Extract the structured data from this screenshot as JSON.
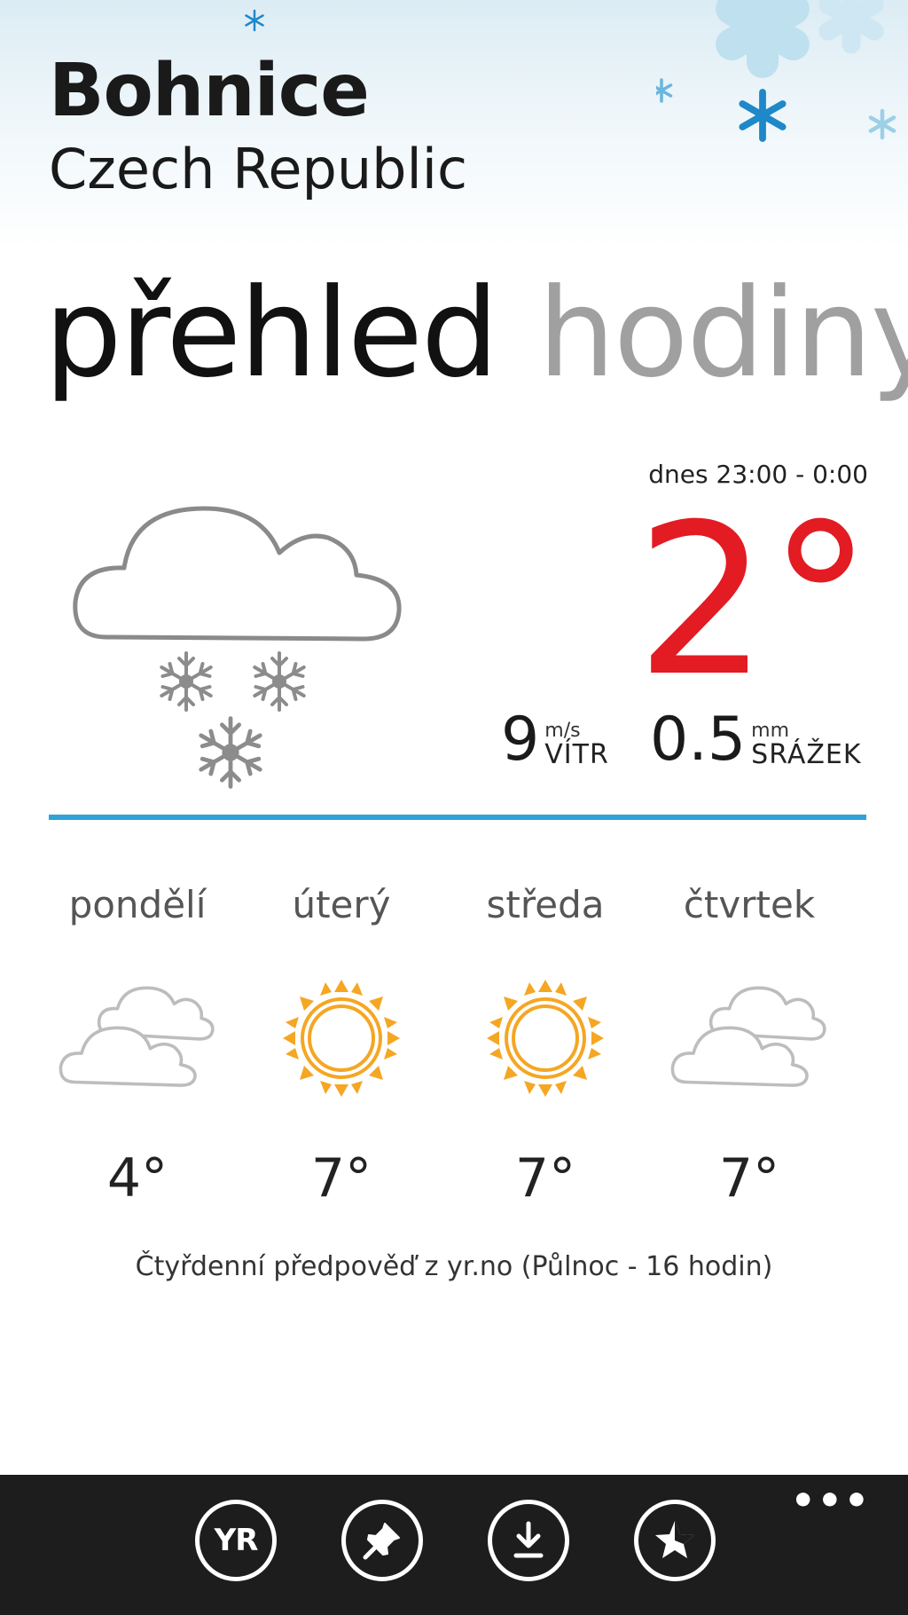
{
  "header": {
    "city": "Bohnice",
    "country": "Czech Republic"
  },
  "pivot": {
    "active": "přehled",
    "next": "hodiny"
  },
  "current": {
    "time_range": "dnes 23:00 - 0:00",
    "temperature": "2°",
    "wind": {
      "value": "9",
      "unit": "m/s",
      "label": "VÍTR"
    },
    "precipitation": {
      "value": "0.5",
      "unit": "mm",
      "label": "SRÁŽEK"
    },
    "icon": "cloud-snow-icon"
  },
  "colors": {
    "temperature": "#e31b23",
    "divider": "#2fa3d6",
    "sun": "#f5a623",
    "appbar": "#1d1d1d"
  },
  "forecast": [
    {
      "day": "pondělí",
      "temp": "4°",
      "icon": "cloudy-icon"
    },
    {
      "day": "úterý",
      "temp": "7°",
      "icon": "sun-icon"
    },
    {
      "day": "středa",
      "temp": "7°",
      "icon": "sun-icon"
    },
    {
      "day": "čtvrtek",
      "temp": "7°",
      "icon": "cloudy-icon"
    }
  ],
  "footnote": "Čtyřdenní předpověď z yr.no (Půlnoc - 16 hodin)",
  "appbar": {
    "buttons": [
      {
        "name": "yr-button",
        "icon": "yr-logo-icon",
        "text": "YR"
      },
      {
        "name": "pin-button",
        "icon": "pin-icon"
      },
      {
        "name": "download-button",
        "icon": "download-icon"
      },
      {
        "name": "favorite-button",
        "icon": "star-icon"
      }
    ],
    "more": "•••"
  }
}
